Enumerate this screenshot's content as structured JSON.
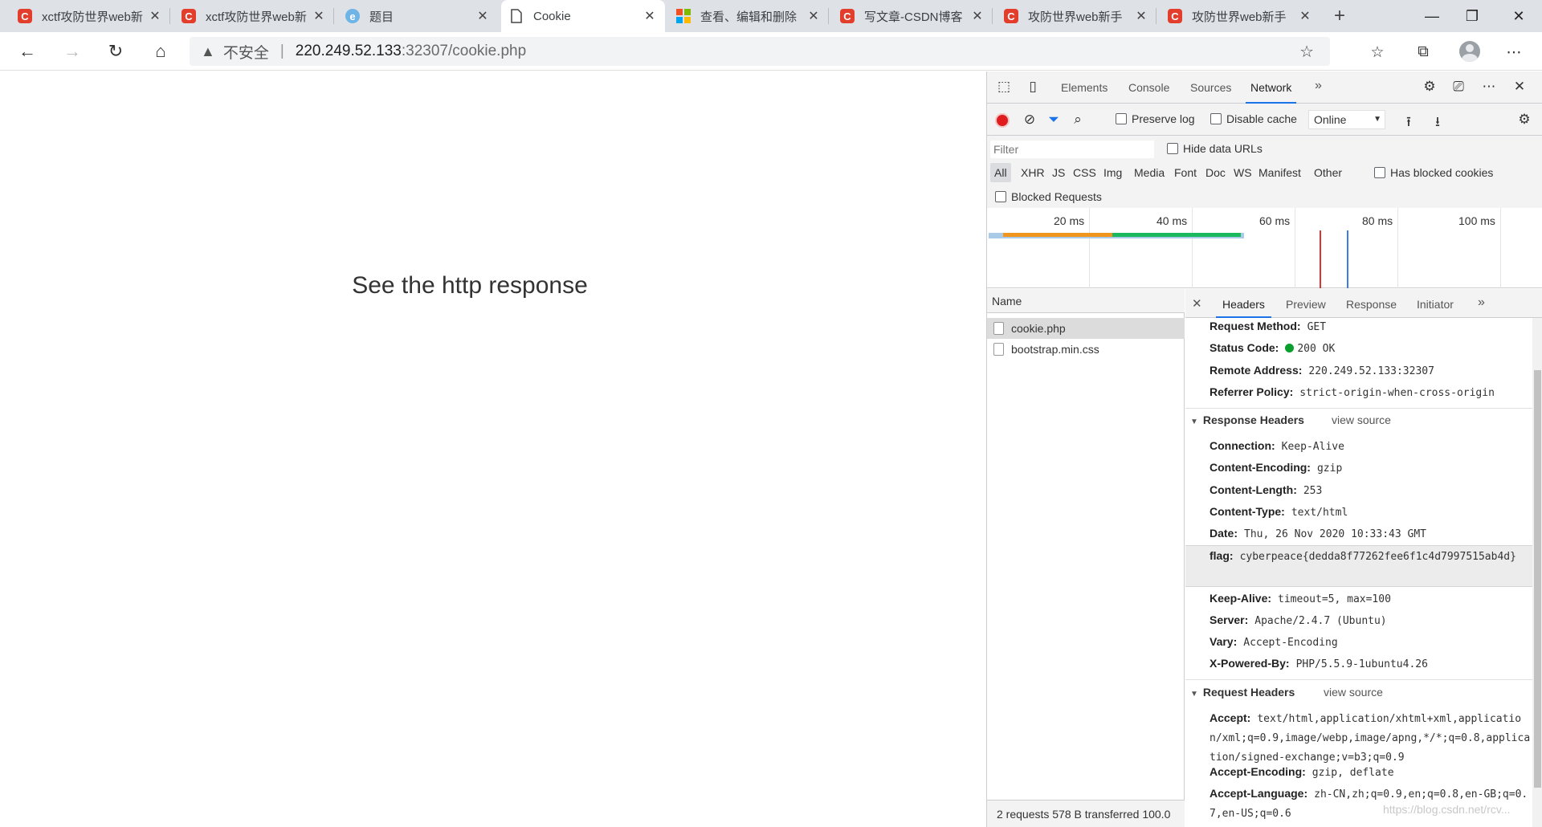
{
  "tabs": [
    {
      "title": "xctf攻防世界web新",
      "favicon": "csdn-icon"
    },
    {
      "title": "xctf攻防世界web新",
      "favicon": "csdn-icon"
    },
    {
      "title": "题目",
      "favicon": "edu-icon"
    },
    {
      "title": "Cookie",
      "favicon": "document-icon",
      "active": true
    },
    {
      "title": "查看、编辑和删除",
      "favicon": "microsoft-icon"
    },
    {
      "title": "写文章-CSDN博客",
      "favicon": "csdn-icon"
    },
    {
      "title": "攻防世界web新手",
      "favicon": "csdn-icon"
    },
    {
      "title": "攻防世界web新手",
      "favicon": "csdn-icon"
    }
  ],
  "window_controls": {
    "minimize": "—",
    "maximize": "❐",
    "close": "✕"
  },
  "address": {
    "insecure_label": "不安全",
    "separator": "|",
    "host": "220.249.52.133",
    "path": ":32307/cookie.php"
  },
  "page": {
    "heading": "See the http response"
  },
  "devtools": {
    "tabs": [
      "Elements",
      "Console",
      "Sources",
      "Network"
    ],
    "active_tab": "Network",
    "more": "»",
    "controls": {
      "preserve_log": "Preserve log",
      "disable_cache": "Disable cache",
      "throttle": "Online"
    },
    "filter": {
      "placeholder": "Filter",
      "hide_data_urls": "Hide data URLs",
      "types": [
        "All",
        "XHR",
        "JS",
        "CSS",
        "Img",
        "Media",
        "Font",
        "Doc",
        "WS",
        "Manifest",
        "Other"
      ],
      "active_type": "All",
      "has_blocked_cookies": "Has blocked cookies",
      "blocked_requests": "Blocked Requests"
    },
    "timeline": {
      "ticks": [
        "20 ms",
        "40 ms",
        "60 ms",
        "80 ms",
        "100 ms"
      ]
    },
    "requests": {
      "column": "Name",
      "items": [
        "cookie.php",
        "bootstrap.min.css"
      ],
      "selected": "cookie.php",
      "status": "2 requests  578 B transferred  100.0"
    },
    "detail_tabs": [
      "Headers",
      "Preview",
      "Response",
      "Initiator"
    ],
    "general": [
      {
        "k": "Request Method:",
        "v": "GET"
      },
      {
        "k": "Status Code:",
        "v": "200 OK"
      },
      {
        "k": "Remote Address:",
        "v": "220.249.52.133:32307"
      },
      {
        "k": "Referrer Policy:",
        "v": "strict-origin-when-cross-origin"
      }
    ],
    "response_headers_title": "Response Headers",
    "view_source": "view source",
    "response_headers": [
      {
        "k": "Connection:",
        "v": "Keep-Alive"
      },
      {
        "k": "Content-Encoding:",
        "v": "gzip"
      },
      {
        "k": "Content-Length:",
        "v": "253"
      },
      {
        "k": "Content-Type:",
        "v": "text/html"
      },
      {
        "k": "Date:",
        "v": "Thu, 26 Nov 2020 10:33:43 GMT"
      },
      {
        "k": "flag:",
        "v": "cyberpeace{dedda8f77262fee6f1c4d7997515ab4d}"
      },
      {
        "k": "Keep-Alive:",
        "v": "timeout=5, max=100"
      },
      {
        "k": "Server:",
        "v": "Apache/2.4.7 (Ubuntu)"
      },
      {
        "k": "Vary:",
        "v": "Accept-Encoding"
      },
      {
        "k": "X-Powered-By:",
        "v": "PHP/5.5.9-1ubuntu4.26"
      }
    ],
    "request_headers_title": "Request Headers",
    "request_headers": [
      {
        "k": "Accept:",
        "v": "text/html,application/xhtml+xml,application/xml;q=0.9,image/webp,image/apng,*/*;q=0.8,application/signed-exchange;v=b3;q=0.9"
      },
      {
        "k": "Accept-Encoding:",
        "v": "gzip, deflate"
      },
      {
        "k": "Accept-Language:",
        "v": "zh-CN,zh;q=0.9,en;q=0.8,en-GB;q=0.7,en-US;q=0.6"
      }
    ]
  },
  "watermark": "https://blog.csdn.net/rcv..."
}
